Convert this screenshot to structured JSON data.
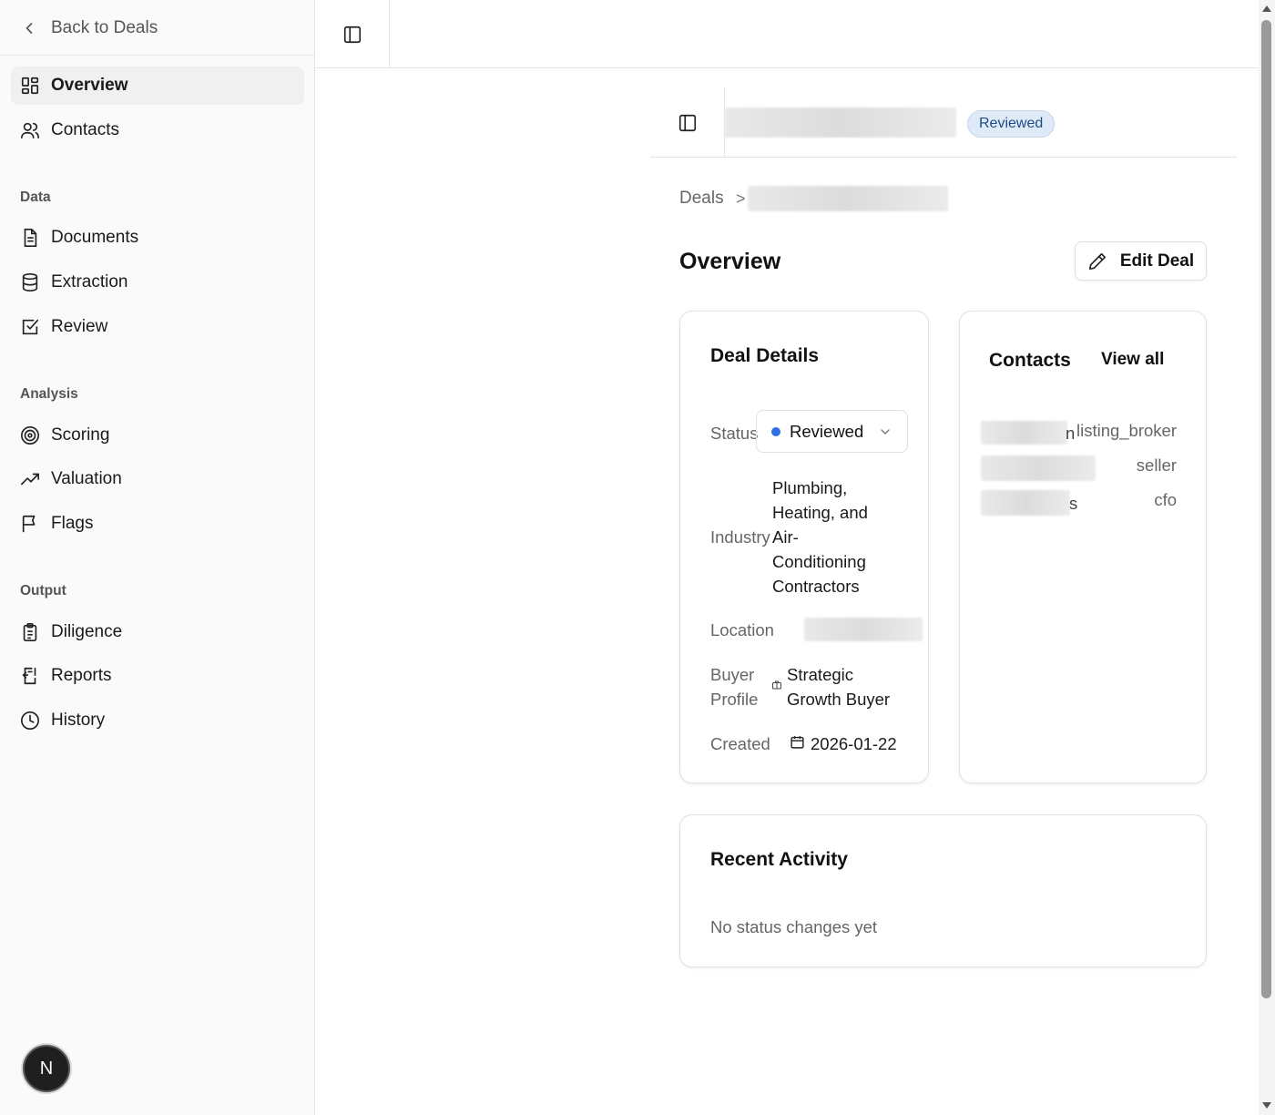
{
  "sidebar": {
    "back_label": "Back to Deals",
    "nav_top": [
      {
        "label": "Overview",
        "icon": "layout-grid-icon",
        "active": true
      },
      {
        "label": "Contacts",
        "icon": "users-icon"
      }
    ],
    "sections": [
      {
        "title": "Data",
        "items": [
          {
            "label": "Documents",
            "icon": "document-icon"
          },
          {
            "label": "Extraction",
            "icon": "database-icon"
          },
          {
            "label": "Review",
            "icon": "check-square-icon"
          }
        ]
      },
      {
        "title": "Analysis",
        "items": [
          {
            "label": "Scoring",
            "icon": "target-icon"
          },
          {
            "label": "Valuation",
            "icon": "trending-up-icon"
          },
          {
            "label": "Flags",
            "icon": "flag-icon"
          }
        ]
      },
      {
        "title": "Output",
        "items": [
          {
            "label": "Diligence",
            "icon": "clipboard-list-icon"
          },
          {
            "label": "Reports",
            "icon": "export-icon"
          },
          {
            "label": "History",
            "icon": "clock-icon"
          }
        ]
      }
    ],
    "avatar_initial": "N"
  },
  "header": {
    "status_badge": "Reviewed"
  },
  "breadcrumb": {
    "root": "Deals",
    "separator": ">"
  },
  "page": {
    "title": "Overview",
    "edit_button": "Edit Deal"
  },
  "deal_details": {
    "title": "Deal Details",
    "status_label": "Status",
    "status_value": "Reviewed",
    "industry_label": "Industry",
    "industry_lines": [
      "Plumbing,",
      "Heating, and",
      "Air-",
      "Conditioning",
      "Contractors"
    ],
    "location_label": "Location",
    "buyer_profile_label_lines": [
      "Buyer",
      "Profile"
    ],
    "buyer_profile_lines": [
      "Strategic",
      "Growth Buyer"
    ],
    "created_label": "Created",
    "created_value": "2026-01-22"
  },
  "contacts": {
    "title": "Contacts",
    "view_all": "View all",
    "rows": [
      {
        "role": "listing_broker",
        "name_tail": "n"
      },
      {
        "role": "seller",
        "name_tail": ""
      },
      {
        "role": "cfo",
        "name_tail": "s"
      }
    ]
  },
  "recent_activity": {
    "title": "Recent Activity",
    "empty_text": "No status changes yet"
  },
  "colors": {
    "accent": "#2f6fe4",
    "badge_bg": "#dfeaf7",
    "badge_text": "#1e4b87"
  }
}
